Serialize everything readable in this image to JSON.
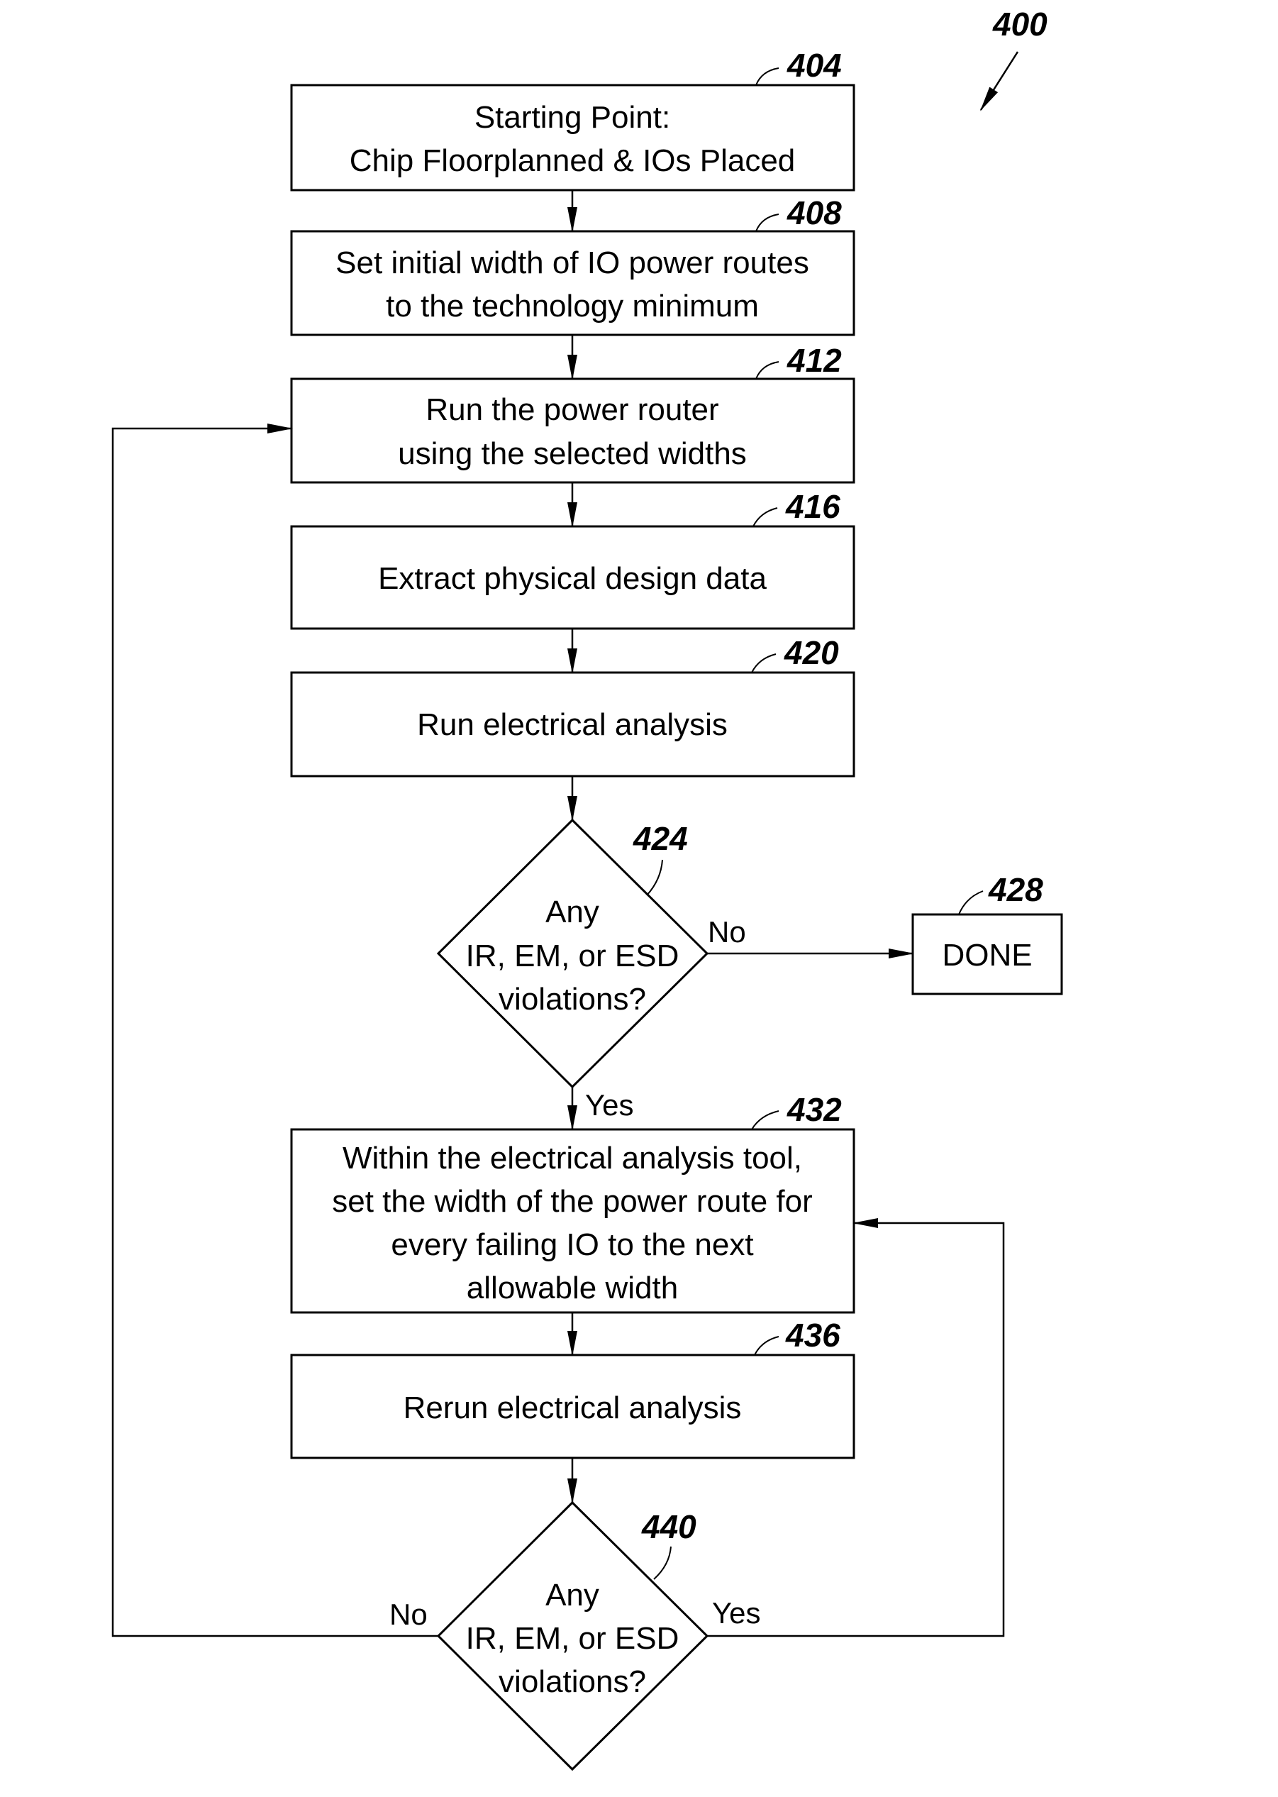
{
  "figure_ref": "400",
  "steps": {
    "s404": {
      "ref": "404",
      "lines": [
        "Starting Point:",
        "Chip Floorplanned & IOs Placed"
      ]
    },
    "s408": {
      "ref": "408",
      "lines": [
        "Set initial width of IO power routes",
        "to the technology minimum"
      ]
    },
    "s412": {
      "ref": "412",
      "lines": [
        "Run the power router",
        "using the selected widths"
      ]
    },
    "s416": {
      "ref": "416",
      "lines": [
        "Extract physical design data"
      ]
    },
    "s420": {
      "ref": "420",
      "lines": [
        "Run electrical analysis"
      ]
    },
    "d424": {
      "ref": "424",
      "lines": [
        "Any",
        "IR, EM, or ESD",
        "violations?"
      ],
      "no_label": "No",
      "yes_label": "Yes"
    },
    "s428": {
      "ref": "428",
      "lines": [
        "DONE"
      ]
    },
    "s432": {
      "ref": "432",
      "lines": [
        "Within the electrical analysis tool,",
        "set the width of the power route for",
        "every failing IO to the next",
        "allowable width"
      ]
    },
    "s436": {
      "ref": "436",
      "lines": [
        "Rerun electrical analysis"
      ]
    },
    "d440": {
      "ref": "440",
      "lines": [
        "Any",
        "IR, EM, or ESD",
        "violations?"
      ],
      "no_label": "No",
      "yes_label": "Yes"
    }
  }
}
